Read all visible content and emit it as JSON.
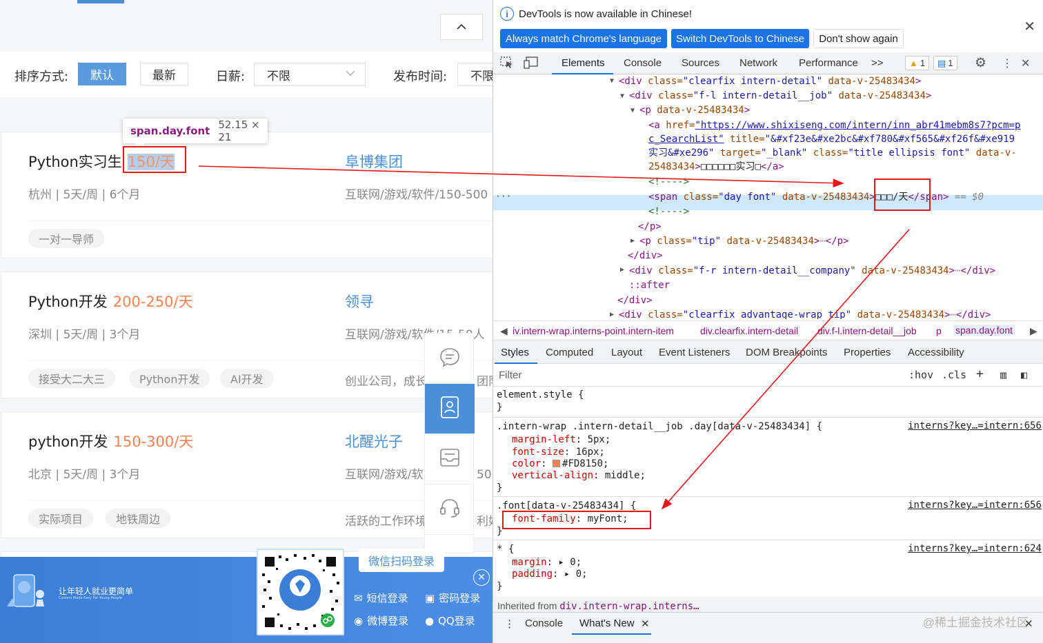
{
  "left_page": {
    "filter": {
      "sort_label": "排序方式:",
      "sort_default": "默认",
      "sort_latest": "最新",
      "salary_label": "日薪:",
      "salary_value": "不限",
      "publish_label": "发布时间:",
      "publish_value": "不限"
    },
    "tooltip": {
      "selector": "span.day.font",
      "size": "52.15 × 21"
    },
    "jobs": [
      {
        "title": "Python实习生",
        "pay": "150/天",
        "company": "阜博集团",
        "meta": "杭州 | 5天/周 | 6个月",
        "industry": "互联网/游戏/软件/150-500",
        "tags": [
          "一对一导师"
        ]
      },
      {
        "title": "Python开发",
        "pay": "200-250/天",
        "company": "领寻",
        "meta": "深圳 | 5天/周 | 3个月",
        "industry": "互联网/游戏/软件/15-50人",
        "tags": [
          "接受大二大三",
          "Python开发",
          "AI开发"
        ],
        "extra": "创业公司，成长",
        "extra2": "团队"
      },
      {
        "title": "python开发",
        "pay": "150-300/天",
        "company": "北醒光子",
        "meta": "北京 | 5天/周 | 3个月",
        "industry": "互联网/游戏/软",
        "industry_tail": "50人",
        "tags": [
          "实际项目",
          "地铁周边"
        ],
        "extra": "活跃的工作环境",
        "extra2": "利好"
      }
    ],
    "login": {
      "slogan": "让年轻人就业更简单",
      "slogan_sub": "Careers Made Easy For Young People",
      "qr_callout": "微信扫码登录",
      "sms": "短信登录",
      "password": "密码登录",
      "weibo": "微博登录",
      "qq": "QQ登录"
    }
  },
  "devtools": {
    "info": {
      "message": "DevTools is now available in Chinese!",
      "btn_match": "Always match Chrome's language",
      "btn_switch": "Switch DevTools to Chinese",
      "btn_dismiss": "Don't show again"
    },
    "tabs": [
      "Elements",
      "Console",
      "Sources",
      "Network",
      "Performance"
    ],
    "more_tabs": ">>",
    "warnings": "1",
    "messages": "1",
    "dom": {
      "l1_tag": "<div ",
      "l1_attr": "class=",
      "l1_val": "\"clearfix intern-detail\"",
      "l1_attr2": " data-v-25483434",
      "l1_end": ">",
      "l2_tag": "<div ",
      "l2_attr": "class=",
      "l2_val": "\"f-l intern-detail__job\"",
      "l2_attr2": " data-v-25483434",
      "l2_end": ">",
      "l3": "<p ",
      "l3_attr": "data-v-25483434",
      "l3_end": ">",
      "l4_a": "<a ",
      "l4_href": "href=",
      "l4_url": "\"https://www.shixiseng.com/intern/inn_abr41mebm8s7?pcm=p",
      "l5_url": "c_SearchList\"",
      "l5_title": " title=",
      "l5_title_val": "\"&#xf23e&#xe2bc&#xf780&#xf565&#xf26f&#xe919",
      "l6_text": "实习&#xe296\"",
      "l6_target": " target=",
      "l6_target_val": "\"_blank\"",
      "l6_class": " class=",
      "l6_class_val": "\"title ellipsis font\"",
      "l6_data": " data-v-",
      "l7_data": "25483434",
      "l7_text": "□□□□□□实习□",
      "l7_close": "</a>",
      "comment": "<!---->",
      "span_tag": "<span ",
      "span_class": "class=",
      "span_class_val": "\"day font\"",
      "span_data": " data-v-25483434",
      "span_text": "□□□/天",
      "span_close": "</span>",
      "span_eq": " == $0",
      "p_close": "</p>",
      "p_tip": "<p ",
      "p_tip_attr": "class=",
      "p_tip_val": "\"tip\"",
      "p_tip_data": " data-v-25483434",
      "p_tip_close": "</p>",
      "div_close": "</div>",
      "company_tag": "<div ",
      "company_attr": "class=",
      "company_val": "\"f-r intern-detail__company\"",
      "company_data": " data-v-25483434",
      "company_close": "</div>",
      "after": "::after",
      "adv_tag": "<div ",
      "adv_attr": "class=",
      "adv_val": "\"clearfix advantage-wrap tip\"",
      "adv_data": " data-v-25483434",
      "adv_close": "</div>"
    },
    "breadcrumbs": [
      "iv.intern-wrap.interns-point.intern-item",
      "div.clearfix.intern-detail",
      "div.f-l.intern-detail__job",
      "p",
      "span.day.font"
    ],
    "subtabs": [
      "Styles",
      "Computed",
      "Layout",
      "Event Listeners",
      "DOM Breakpoints",
      "Properties",
      "Accessibility"
    ],
    "filter_placeholder": "Filter",
    "filter_hov": ":hov",
    "filter_cls": ".cls",
    "styles": {
      "element_style": "element.style {",
      "close": "}",
      "rule1_selector": ".intern-wrap .intern-detail__job .day[data-v-25483434] {",
      "rule1_src": "interns?key…=intern:656",
      "rule1_props": [
        {
          "name": "margin-left",
          "value": "5px;"
        },
        {
          "name": "font-size",
          "value": "16px;"
        },
        {
          "name": "color",
          "value": "#FD8150;"
        },
        {
          "name": "vertical-align",
          "value": "middle;"
        }
      ],
      "rule2_selector": ".font[data-v-25483434] {",
      "rule2_src": "interns?key…=intern:656",
      "rule2_prop": "font-family",
      "rule2_value": "myFont;",
      "rule3_selector": "* {",
      "rule3_src": "interns?key…=intern:624",
      "rule3_props": [
        {
          "name": "margin",
          "value": "0;"
        },
        {
          "name": "padding",
          "value": "0;"
        }
      ],
      "inherited_label": "Inherited from ",
      "inherited_sel": "div.intern-wrap.interns…"
    },
    "drawer": {
      "console": "Console",
      "whats_new": "What's New",
      "watermark": "@稀土掘金技术社区"
    }
  },
  "colors": {
    "pay": "#fd8150",
    "link": "#4b8fd8",
    "devtools_blue": "#1a73e8",
    "annotation_red": "#e8161b"
  }
}
